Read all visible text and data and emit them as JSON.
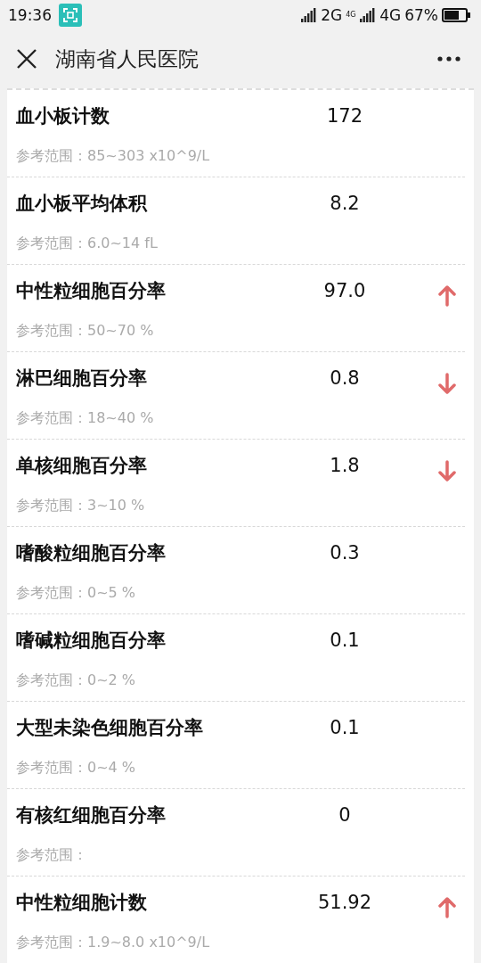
{
  "status_bar": {
    "time": "19:36",
    "network_1": "2G",
    "network_2_small": "4G",
    "network_2": "4G",
    "battery": "67%"
  },
  "header": {
    "title": "湖南省人民医院"
  },
  "results": [
    {
      "name": "血小板计数",
      "value": "172",
      "range": "参考范围：85~303 x10^9/L",
      "high": false,
      "low": false
    },
    {
      "name": "血小板平均体积",
      "value": "8.2",
      "range": "参考范围：6.0~14 fL",
      "high": false,
      "low": false
    },
    {
      "name": "中性粒细胞百分率",
      "value": "97.0",
      "range": "参考范围：50~70 %",
      "high": true,
      "low": false
    },
    {
      "name": "淋巴细胞百分率",
      "value": "0.8",
      "range": "参考范围：18~40 %",
      "high": false,
      "low": true
    },
    {
      "name": "单核细胞百分率",
      "value": "1.8",
      "range": "参考范围：3~10 %",
      "high": false,
      "low": true
    },
    {
      "name": "嗜酸粒细胞百分率",
      "value": "0.3",
      "range": "参考范围：0~5 %",
      "high": false,
      "low": false
    },
    {
      "name": "嗜碱粒细胞百分率",
      "value": "0.1",
      "range": "参考范围：0~2 %",
      "high": false,
      "low": false
    },
    {
      "name": "大型未染色细胞百分率",
      "value": "0.1",
      "range": "参考范围：0~4 %",
      "high": false,
      "low": false
    },
    {
      "name": "有核红细胞百分率",
      "value": "0",
      "range": "参考范围：",
      "high": false,
      "low": false
    },
    {
      "name": "中性粒细胞计数",
      "value": "51.92",
      "range": "参考范围：1.9~8.0 x10^9/L",
      "high": true,
      "low": false
    }
  ]
}
